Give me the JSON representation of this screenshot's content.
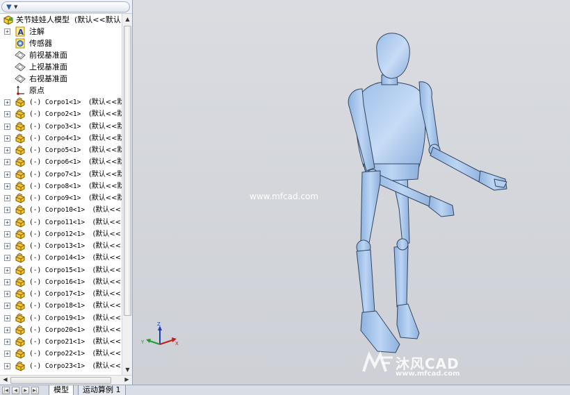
{
  "filter": {
    "icon": "filter-funnel-icon"
  },
  "tree": {
    "root": {
      "label": "关节娃娃人模型",
      "config": "(默认<<默认"
    },
    "annotations": "注解",
    "sensors": "传感器",
    "front_plane": "前视基准面",
    "top_plane": "上视基准面",
    "right_plane": "右视基准面",
    "origin": "原点",
    "parts": [
      {
        "label": "(-) Corpo1<1>",
        "config": "(默认<<默"
      },
      {
        "label": "(-) Corpo2<1>",
        "config": "(默认<<默"
      },
      {
        "label": "(-) Corpo3<1>",
        "config": "(默认<<默"
      },
      {
        "label": "(-) Corpo4<1>",
        "config": "(默认<<默"
      },
      {
        "label": "(-) Corpo5<1>",
        "config": "(默认<<默"
      },
      {
        "label": "(-) Corpo6<1>",
        "config": "(默认<<默"
      },
      {
        "label": "(-) Corpo7<1>",
        "config": "(默认<<默"
      },
      {
        "label": "(-) Corpo8<1>",
        "config": "(默认<<默"
      },
      {
        "label": "(-) Corpo9<1>",
        "config": "(默认<<默"
      },
      {
        "label": "(-) Corpo10<1>",
        "config": "(默认<<鬻"
      },
      {
        "label": "(-) Corpo11<1>",
        "config": "(默认<<鬻"
      },
      {
        "label": "(-) Corpo12<1>",
        "config": "(默认<<鬻"
      },
      {
        "label": "(-) Corpo13<1>",
        "config": "(默认<<鬻"
      },
      {
        "label": "(-) Corpo14<1>",
        "config": "(默认<<鬻"
      },
      {
        "label": "(-) Corpo15<1>",
        "config": "(默认<<鬻"
      },
      {
        "label": "(-) Corpo16<1>",
        "config": "(默认<<鬻"
      },
      {
        "label": "(-) Corpo17<1>",
        "config": "(默认<<鬻"
      },
      {
        "label": "(-) Corpo18<1>",
        "config": "(默认<<鬻"
      },
      {
        "label": "(-) Corpo19<1>",
        "config": "(默认<<鬻"
      },
      {
        "label": "(-) Corpo20<1>",
        "config": "(默认<<鬻"
      },
      {
        "label": "(-) Corpo21<1>",
        "config": "(默认<<鬻"
      },
      {
        "label": "(-) Corpo22<1>",
        "config": "(默认<<鬻"
      },
      {
        "label": "(-) Corpo23<1>",
        "config": "(默认<<鬻"
      }
    ]
  },
  "viewport": {
    "watermark_top": "www.mfcad.com",
    "watermark_brand": "沐风CAD",
    "watermark_url": "www.mfcad.com",
    "triad": {
      "x": "X",
      "y": "Y",
      "z": "Z"
    },
    "model_color": "#a9c6ea"
  },
  "tabs": {
    "model": "模型",
    "motion": "运动算例 1"
  }
}
